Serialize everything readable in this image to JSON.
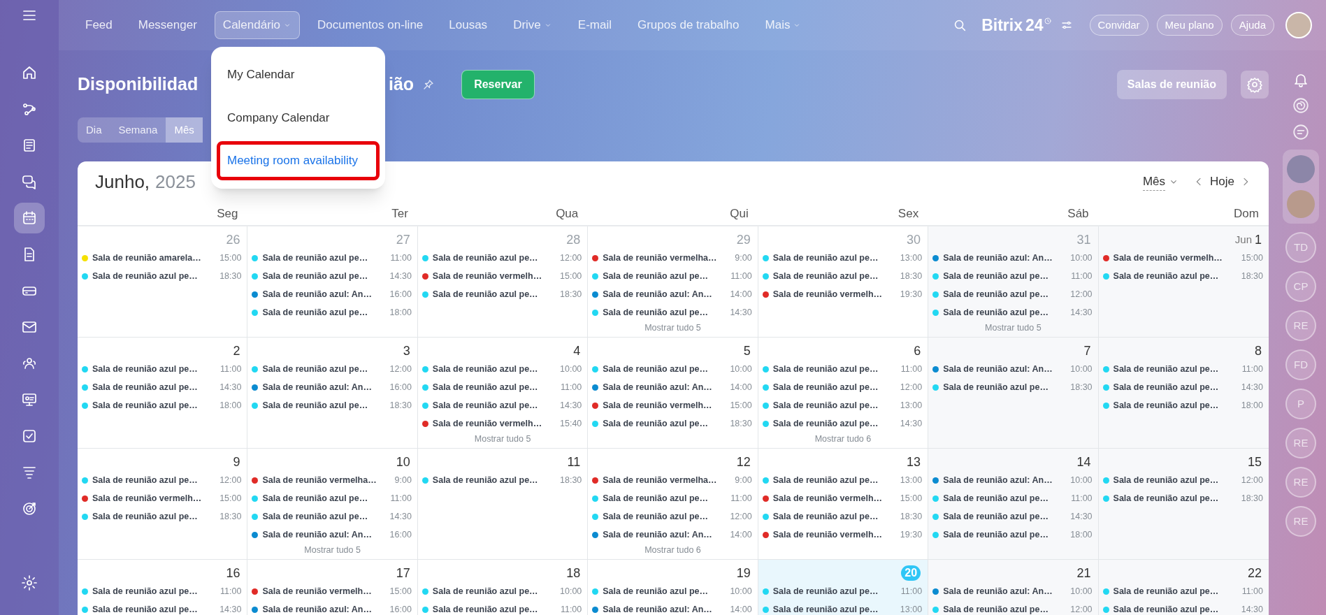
{
  "left_sidebar": {
    "items": [
      {
        "selected": false
      },
      {
        "selected": false
      },
      {
        "selected": false
      },
      {
        "selected": false
      },
      {
        "selected": false
      },
      {
        "selected": true
      },
      {
        "selected": false
      },
      {
        "selected": false
      },
      {
        "selected": false
      },
      {
        "selected": false
      },
      {
        "selected": false
      },
      {
        "selected": false
      },
      {
        "selected": false
      },
      {
        "selected": false
      },
      {
        "selected": false
      }
    ]
  },
  "top_nav": {
    "items": [
      {
        "label": "Feed",
        "selected": false,
        "has_menu": false
      },
      {
        "label": "Messenger",
        "selected": false,
        "has_menu": false
      },
      {
        "label": "Calendário",
        "selected": true,
        "has_menu": true
      },
      {
        "label": "Documentos on-line",
        "selected": false,
        "has_menu": false
      },
      {
        "label": "Lousas",
        "selected": false,
        "has_menu": false
      },
      {
        "label": "Drive",
        "selected": false,
        "has_menu": true
      },
      {
        "label": "E-mail",
        "selected": false,
        "has_menu": false
      },
      {
        "label": "Grupos de trabalho",
        "selected": false,
        "has_menu": false
      },
      {
        "label": "Mais",
        "selected": false,
        "has_menu": true
      }
    ]
  },
  "logo": {
    "name": "Bitrix",
    "number": "24"
  },
  "header_buttons": [
    "Convidar",
    "Meu plano",
    "Ajuda"
  ],
  "nav_dropdown": {
    "items": [
      {
        "label": "My Calendar",
        "selected": false
      },
      {
        "label": "Company Calendar",
        "selected": false
      },
      {
        "label": "Meeting room availability",
        "selected": true
      }
    ]
  },
  "page": {
    "title_start": "Disponibilidad",
    "title_end": "ião",
    "primary_button": "Reservar",
    "rooms_button": "Salas de reunião"
  },
  "view_tabs": [
    {
      "label": "Dia",
      "selected": false
    },
    {
      "label": "Semana",
      "selected": false
    },
    {
      "label": "Mês",
      "selected": true
    }
  ],
  "calendar": {
    "month": "Junho,",
    "year": "2025",
    "view_select": "Mês",
    "today_button": "Hoje",
    "weekdays": [
      "Seg",
      "Ter",
      "Qua",
      "Qui",
      "Sex",
      "Sáb",
      "Dom"
    ],
    "weeks": [
      {
        "days": [
          {
            "date": "26",
            "other_month": true,
            "today": false,
            "events": [
              {
                "title": "Sala de reunião amarela…",
                "time": "15:00",
                "color": "#f5e100"
              },
              {
                "title": "Sala de reunião azul pe…",
                "time": "18:30",
                "color": "#22d8f2"
              }
            ]
          },
          {
            "date": "27",
            "other_month": true,
            "today": false,
            "events": [
              {
                "title": "Sala de reunião azul pe…",
                "time": "11:00",
                "color": "#22d8f2"
              },
              {
                "title": "Sala de reunião azul pe…",
                "time": "14:30",
                "color": "#22d8f2"
              },
              {
                "title": "Sala de reunião azul: An…",
                "time": "16:00",
                "color": "#0b8bd0"
              },
              {
                "title": "Sala de reunião azul pe…",
                "time": "18:00",
                "color": "#22d8f2"
              }
            ]
          },
          {
            "date": "28",
            "other_month": true,
            "today": false,
            "events": [
              {
                "title": "Sala de reunião azul pe…",
                "time": "12:00",
                "color": "#22d8f2"
              },
              {
                "title": "Sala de reunião vermelh…",
                "time": "15:00",
                "color": "#e02b27"
              },
              {
                "title": "Sala de reunião azul pe…",
                "time": "18:30",
                "color": "#22d8f2"
              }
            ]
          },
          {
            "date": "29",
            "other_month": true,
            "today": false,
            "events": [
              {
                "title": "Sala de reunião vermelha…",
                "time": "9:00",
                "color": "#e02b27"
              },
              {
                "title": "Sala de reunião azul pe…",
                "time": "11:00",
                "color": "#22d8f2"
              },
              {
                "title": "Sala de reunião azul: An…",
                "time": "14:00",
                "color": "#0b8bd0"
              },
              {
                "title": "Sala de reunião azul pe…",
                "time": "14:30",
                "color": "#22d8f2"
              }
            ],
            "more": "Mostrar tudo 5"
          },
          {
            "date": "30",
            "other_month": true,
            "today": false,
            "events": [
              {
                "title": "Sala de reunião azul pe…",
                "time": "13:00",
                "color": "#22d8f2"
              },
              {
                "title": "Sala de reunião azul pe…",
                "time": "18:30",
                "color": "#22d8f2"
              },
              {
                "title": "Sala de reunião vermelh…",
                "time": "19:30",
                "color": "#e02b27"
              }
            ]
          },
          {
            "date": "31",
            "other_month": true,
            "today": false,
            "events": [
              {
                "title": "Sala de reunião azul: An…",
                "time": "10:00",
                "color": "#0b8bd0"
              },
              {
                "title": "Sala de reunião azul pe…",
                "time": "11:00",
                "color": "#22d8f2"
              },
              {
                "title": "Sala de reunião azul pe…",
                "time": "12:00",
                "color": "#22d8f2"
              },
              {
                "title": "Sala de reunião azul pe…",
                "time": "14:30",
                "color": "#22d8f2"
              }
            ],
            "more": "Mostrar tudo 5"
          },
          {
            "month_label": "Jun",
            "date": "1",
            "other_month": false,
            "today": false,
            "events": [
              {
                "title": "Sala de reunião vermelh…",
                "time": "15:00",
                "color": "#e02b27"
              },
              {
                "title": "Sala de reunião azul pe…",
                "time": "18:30",
                "color": "#22d8f2"
              }
            ]
          }
        ]
      },
      {
        "days": [
          {
            "date": "2",
            "other_month": false,
            "today": false,
            "events": [
              {
                "title": "Sala de reunião azul pe…",
                "time": "11:00",
                "color": "#22d8f2"
              },
              {
                "title": "Sala de reunião azul pe…",
                "time": "14:30",
                "color": "#22d8f2"
              },
              {
                "title": "Sala de reunião azul pe…",
                "time": "18:00",
                "color": "#22d8f2"
              }
            ]
          },
          {
            "date": "3",
            "other_month": false,
            "today": false,
            "events": [
              {
                "title": "Sala de reunião azul pe…",
                "time": "12:00",
                "color": "#22d8f2"
              },
              {
                "title": "Sala de reunião azul: An…",
                "time": "16:00",
                "color": "#0b8bd0"
              },
              {
                "title": "Sala de reunião azul pe…",
                "time": "18:30",
                "color": "#22d8f2"
              }
            ]
          },
          {
            "date": "4",
            "other_month": false,
            "today": false,
            "events": [
              {
                "title": "Sala de reunião azul pe…",
                "time": "10:00",
                "color": "#22d8f2"
              },
              {
                "title": "Sala de reunião azul pe…",
                "time": "11:00",
                "color": "#22d8f2"
              },
              {
                "title": "Sala de reunião azul pe…",
                "time": "14:30",
                "color": "#22d8f2"
              },
              {
                "title": "Sala de reunião vermelh…",
                "time": "15:40",
                "color": "#e02b27"
              }
            ],
            "more": "Mostrar tudo 5"
          },
          {
            "date": "5",
            "other_month": false,
            "today": false,
            "events": [
              {
                "title": "Sala de reunião azul pe…",
                "time": "10:00",
                "color": "#22d8f2"
              },
              {
                "title": "Sala de reunião azul: An…",
                "time": "14:00",
                "color": "#0b8bd0"
              },
              {
                "title": "Sala de reunião vermelh…",
                "time": "15:00",
                "color": "#e02b27"
              },
              {
                "title": "Sala de reunião azul pe…",
                "time": "18:30",
                "color": "#22d8f2"
              }
            ]
          },
          {
            "date": "6",
            "other_month": false,
            "today": false,
            "events": [
              {
                "title": "Sala de reunião azul pe…",
                "time": "11:00",
                "color": "#22d8f2"
              },
              {
                "title": "Sala de reunião azul pe…",
                "time": "12:00",
                "color": "#22d8f2"
              },
              {
                "title": "Sala de reunião azul pe…",
                "time": "13:00",
                "color": "#22d8f2"
              },
              {
                "title": "Sala de reunião azul pe…",
                "time": "14:30",
                "color": "#22d8f2"
              }
            ],
            "more": "Mostrar tudo 6"
          },
          {
            "date": "7",
            "other_month": false,
            "today": false,
            "events": [
              {
                "title": "Sala de reunião azul: An…",
                "time": "10:00",
                "color": "#0b8bd0"
              },
              {
                "title": "Sala de reunião azul pe…",
                "time": "18:30",
                "color": "#22d8f2"
              }
            ]
          },
          {
            "date": "8",
            "other_month": false,
            "today": false,
            "events": [
              {
                "title": "Sala de reunião azul pe…",
                "time": "11:00",
                "color": "#22d8f2"
              },
              {
                "title": "Sala de reunião azul pe…",
                "time": "14:30",
                "color": "#22d8f2"
              },
              {
                "title": "Sala de reunião azul pe…",
                "time": "18:00",
                "color": "#22d8f2"
              }
            ]
          }
        ]
      },
      {
        "days": [
          {
            "date": "9",
            "other_month": false,
            "today": false,
            "events": [
              {
                "title": "Sala de reunião azul pe…",
                "time": "12:00",
                "color": "#22d8f2"
              },
              {
                "title": "Sala de reunião vermelh…",
                "time": "15:00",
                "color": "#e02b27"
              },
              {
                "title": "Sala de reunião azul pe…",
                "time": "18:30",
                "color": "#22d8f2"
              }
            ]
          },
          {
            "date": "10",
            "other_month": false,
            "today": false,
            "events": [
              {
                "title": "Sala de reunião vermelha…",
                "time": "9:00",
                "color": "#e02b27"
              },
              {
                "title": "Sala de reunião azul pe…",
                "time": "11:00",
                "color": "#22d8f2"
              },
              {
                "title": "Sala de reunião azul pe…",
                "time": "14:30",
                "color": "#22d8f2"
              },
              {
                "title": "Sala de reunião azul: An…",
                "time": "16:00",
                "color": "#0b8bd0"
              }
            ],
            "more": "Mostrar tudo 5"
          },
          {
            "date": "11",
            "other_month": false,
            "today": false,
            "events": [
              {
                "title": "Sala de reunião azul pe…",
                "time": "18:30",
                "color": "#22d8f2"
              }
            ]
          },
          {
            "date": "12",
            "other_month": false,
            "today": false,
            "events": [
              {
                "title": "Sala de reunião vermelha…",
                "time": "9:00",
                "color": "#e02b27"
              },
              {
                "title": "Sala de reunião azul pe…",
                "time": "11:00",
                "color": "#22d8f2"
              },
              {
                "title": "Sala de reunião azul pe…",
                "time": "12:00",
                "color": "#22d8f2"
              },
              {
                "title": "Sala de reunião azul: An…",
                "time": "14:00",
                "color": "#0b8bd0"
              }
            ],
            "more": "Mostrar tudo 6"
          },
          {
            "date": "13",
            "other_month": false,
            "today": false,
            "events": [
              {
                "title": "Sala de reunião azul pe…",
                "time": "13:00",
                "color": "#22d8f2"
              },
              {
                "title": "Sala de reunião vermelh…",
                "time": "15:00",
                "color": "#e02b27"
              },
              {
                "title": "Sala de reunião azul pe…",
                "time": "18:30",
                "color": "#22d8f2"
              },
              {
                "title": "Sala de reunião vermelh…",
                "time": "19:30",
                "color": "#e02b27"
              }
            ]
          },
          {
            "date": "14",
            "other_month": false,
            "today": false,
            "events": [
              {
                "title": "Sala de reunião azul: An…",
                "time": "10:00",
                "color": "#0b8bd0"
              },
              {
                "title": "Sala de reunião azul pe…",
                "time": "11:00",
                "color": "#22d8f2"
              },
              {
                "title": "Sala de reunião azul pe…",
                "time": "14:30",
                "color": "#22d8f2"
              },
              {
                "title": "Sala de reunião azul pe…",
                "time": "18:00",
                "color": "#22d8f2"
              }
            ]
          },
          {
            "date": "15",
            "other_month": false,
            "today": false,
            "events": [
              {
                "title": "Sala de reunião azul pe…",
                "time": "12:00",
                "color": "#22d8f2"
              },
              {
                "title": "Sala de reunião azul pe…",
                "time": "18:30",
                "color": "#22d8f2"
              }
            ]
          }
        ]
      },
      {
        "days": [
          {
            "date": "16",
            "other_month": false,
            "today": false,
            "events": [
              {
                "title": "Sala de reunião azul pe…",
                "time": "11:00",
                "color": "#22d8f2"
              },
              {
                "title": "Sala de reunião azul pe…",
                "time": "14:30",
                "color": "#22d8f2"
              }
            ]
          },
          {
            "date": "17",
            "other_month": false,
            "today": false,
            "events": [
              {
                "title": "Sala de reunião vermelh…",
                "time": "15:00",
                "color": "#e02b27"
              },
              {
                "title": "Sala de reunião azul: An…",
                "time": "16:00",
                "color": "#0b8bd0"
              }
            ]
          },
          {
            "date": "18",
            "other_month": false,
            "today": false,
            "events": [
              {
                "title": "Sala de reunião azul pe…",
                "time": "10:00",
                "color": "#22d8f2"
              },
              {
                "title": "Sala de reunião azul pe…",
                "time": "11:00",
                "color": "#22d8f2"
              }
            ]
          },
          {
            "date": "19",
            "other_month": false,
            "today": false,
            "events": [
              {
                "title": "Sala de reunião azul pe…",
                "time": "10:00",
                "color": "#22d8f2"
              },
              {
                "title": "Sala de reunião azul: An…",
                "time": "14:00",
                "color": "#0b8bd0"
              }
            ]
          },
          {
            "date": "20",
            "other_month": false,
            "today": true,
            "events": [
              {
                "title": "Sala de reunião azul pe…",
                "time": "11:00",
                "color": "#22d8f2"
              },
              {
                "title": "Sala de reunião azul pe…",
                "time": "13:00",
                "color": "#22d8f2"
              }
            ]
          },
          {
            "date": "21",
            "other_month": false,
            "today": false,
            "events": [
              {
                "title": "Sala de reunião azul: An…",
                "time": "10:00",
                "color": "#0b8bd0"
              },
              {
                "title": "Sala de reunião azul pe…",
                "time": "12:00",
                "color": "#22d8f2"
              }
            ]
          },
          {
            "date": "22",
            "other_month": false,
            "today": false,
            "events": [
              {
                "title": "Sala de reunião azul pe…",
                "time": "11:00",
                "color": "#22d8f2"
              },
              {
                "title": "Sala de reunião azul pe…",
                "time": "14:30",
                "color": "#22d8f2"
              }
            ]
          }
        ]
      }
    ]
  },
  "right_rail": {
    "initials": [
      "TD",
      "CP",
      "RE",
      "FD",
      "P",
      "RE",
      "RE",
      "RE"
    ]
  }
}
